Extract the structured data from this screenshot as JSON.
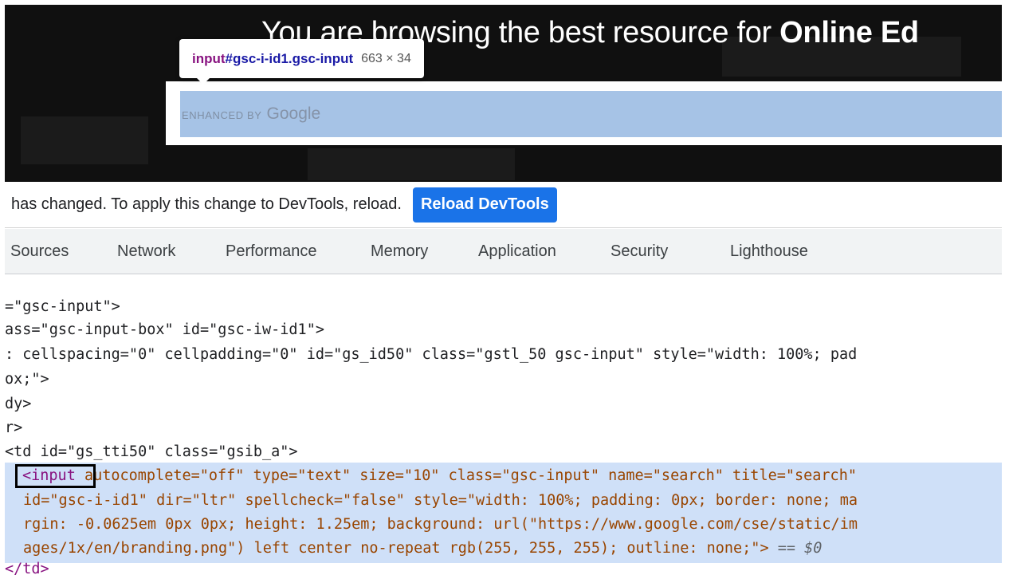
{
  "page": {
    "hero_text": "You are browsing the best resource for ",
    "hero_text_bold": "Online Ed"
  },
  "search": {
    "branding_prefix": "ENHANCED BY",
    "branding_logo": "Google"
  },
  "tooltip": {
    "tag": "input",
    "selector": "#gsc-i-id1.gsc-input",
    "size": "663 × 34"
  },
  "infobar": {
    "message": "has changed. To apply this change to DevTools, reload.",
    "button_label": "Reload DevTools",
    "button_color": "#1a73e8"
  },
  "tabs": [
    "Sources",
    "Network",
    "Performance",
    "Memory",
    "Application",
    "Security",
    "Lighthouse"
  ],
  "dom": {
    "l1": "=\"gsc-input\">",
    "l2": "ass=\"gsc-input-box\" id=\"gsc-iw-id1\">",
    "l3": ": cellspacing=\"0\" cellpadding=\"0\" id=\"gs_id50\" class=\"gstl_50 gsc-input\" style=\"width: 100%; pad",
    "l4": "ox;\">",
    "l5": "dy>",
    "l6": "r>",
    "l7": "<td id=\"gs_tti50\" class=\"gsib_a\">",
    "selected": {
      "tag": "<input",
      "l1": " autocomplete=\"off\" type=\"text\" size=\"10\" class=\"gsc-input\" name=\"search\" title=\"search\"",
      "l2": "id=\"gsc-i-id1\" dir=\"ltr\" spellcheck=\"false\" style=\"width: 100%; padding: 0px; border: none; ma",
      "l3": "rgin: -0.0625em 0px 0px; height: 1.25em; background: url(\"https://www.google.com/cse/static/im",
      "l4": "ages/1x/en/branding.png\") left center no-repeat rgb(255, 255, 255); outline: none;\">",
      "marker": "== $0"
    },
    "close": "</td>"
  },
  "colors": {
    "selected_row": "#cfe0f8",
    "search_highlight": "#a6c3e6",
    "tag": "#881280",
    "attr_name": "#994500",
    "attr_value": "#1a1aa6"
  }
}
